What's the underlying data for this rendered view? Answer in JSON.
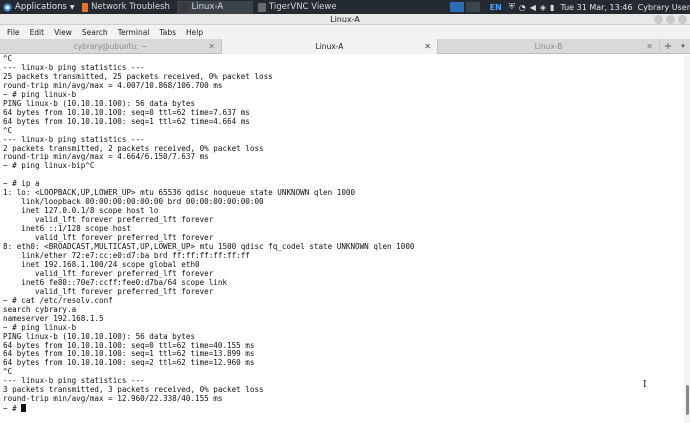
{
  "panel": {
    "applications_label": "Applications",
    "tasks": [
      {
        "label": "Network Troubleshootin...",
        "icon_color": "#e8732c",
        "state": "normal"
      },
      {
        "label": "Linux-A",
        "icon_color": "#3b3b3b",
        "state": "active"
      },
      {
        "label": "TigerVNC Viewer",
        "icon_color": "#6b6b6b",
        "state": "normal"
      }
    ],
    "lang": "EN",
    "tray_icons": [
      "shield-icon",
      "wifi-icon",
      "volume-icon",
      "bell-icon",
      "battery-icon"
    ],
    "clock": "Tue 31 Mar, 13:46",
    "user": "Cybrary User"
  },
  "window": {
    "title": "Linux-A"
  },
  "menu": [
    "File",
    "Edit",
    "View",
    "Search",
    "Terminal",
    "Tabs",
    "Help"
  ],
  "tabs": [
    {
      "label": "cybrary@ubuntu: ~",
      "selected": false
    },
    {
      "label": "Linux-A",
      "selected": true
    },
    {
      "label": "Linux-B",
      "selected": false
    }
  ],
  "terminal": {
    "lines": [
      "^C",
      "--- linux-b ping statistics ---",
      "25 packets transmitted, 25 packets received, 0% packet loss",
      "round-trip min/avg/max = 4.007/10.868/106.700 ms",
      "~ # ping linux-b",
      "PING linux-b (10.10.10.100): 56 data bytes",
      "64 bytes from 10.10.10.100: seq=0 ttl=62 time=7.637 ms",
      "64 bytes from 10.10.10.100: seq=1 ttl=62 time=4.664 ms",
      "^C",
      "--- linux-b ping statistics ---",
      "2 packets transmitted, 2 packets received, 0% packet loss",
      "round-trip min/avg/max = 4.664/6.150/7.637 ms",
      "~ # ping linux-bip^C",
      "",
      "~ # ip a",
      "1: lo: <LOOPBACK,UP,LOWER_UP> mtu 65536 qdisc noqueue state UNKNOWN qlen 1000",
      "    link/loopback 00:00:00:00:00:00 brd 00:00:00:00:00:00",
      "    inet 127.0.0.1/8 scope host lo",
      "       valid_lft forever preferred_lft forever",
      "    inet6 ::1/128 scope host",
      "       valid_lft forever preferred_lft forever",
      "8: eth0: <BROADCAST,MULTICAST,UP,LOWER_UP> mtu 1500 qdisc fq_codel state UNKNOWN qlen 1000",
      "    link/ether 72:e7:cc:e0:d7:ba brd ff:ff:ff:ff:ff:ff",
      "    inet 192.168.1.100/24 scope global eth0",
      "       valid_lft forever preferred_lft forever",
      "    inet6 fe80::70e7:ccff:fee0:d7ba/64 scope link",
      "       valid_lft forever preferred_lft forever",
      "~ # cat /etc/resolv.conf",
      "search cybrary.a",
      "nameserver 192.168.1.5",
      "~ # ping linux-b",
      "PING linux-b (10.10.10.100): 56 data bytes",
      "64 bytes from 10.10.10.100: seq=0 ttl=62 time=40.155 ms",
      "64 bytes from 10.10.10.100: seq=1 ttl=62 time=13.899 ms",
      "64 bytes from 10.10.10.100: seq=2 ttl=62 time=12.960 ms",
      "^C",
      "--- linux-b ping statistics ---",
      "3 packets transmitted, 3 packets received, 0% packet loss",
      "round-trip min/avg/max = 12.960/22.338/40.155 ms"
    ],
    "prompt": "~ # "
  }
}
